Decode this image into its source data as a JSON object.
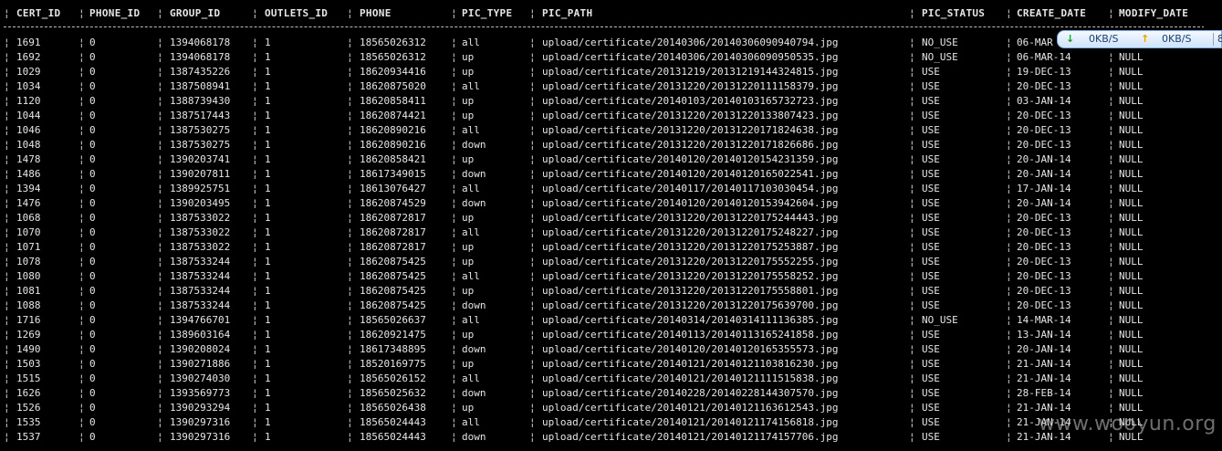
{
  "table": {
    "columns": [
      {
        "key": "cert_id",
        "label": "CERT_ID"
      },
      {
        "key": "phone_id",
        "label": "PHONE_ID"
      },
      {
        "key": "group_id",
        "label": "GROUP_ID"
      },
      {
        "key": "outlets_id",
        "label": "OUTLETS_ID"
      },
      {
        "key": "phone",
        "label": "PHONE"
      },
      {
        "key": "pic_type",
        "label": "PIC_TYPE"
      },
      {
        "key": "pic_path",
        "label": "PIC_PATH"
      },
      {
        "key": "pic_status",
        "label": "PIC_STATUS"
      },
      {
        "key": "create_date",
        "label": "CREATE_DATE"
      },
      {
        "key": "modify_date",
        "label": "MODIFY_DATE"
      }
    ],
    "rows": [
      [
        "1691",
        "0",
        "1394068178",
        "1",
        "18565026312",
        "all",
        "upload/certificate/20140306/20140306090940794.jpg",
        "NO_USE",
        "06-MAR",
        ""
      ],
      [
        "1692",
        "0",
        "1394068178",
        "1",
        "18565026312",
        "up",
        "upload/certificate/20140306/20140306090950535.jpg",
        "NO_USE",
        "06-MAR-14",
        "NULL"
      ],
      [
        "1029",
        "0",
        "1387435226",
        "1",
        "18620934416",
        "up",
        "upload/certificate/20131219/20131219144324815.jpg",
        "USE",
        "19-DEC-13",
        "NULL"
      ],
      [
        "1034",
        "0",
        "1387508941",
        "1",
        "18620875020",
        "all",
        "upload/certificate/20131220/20131220111158379.jpg",
        "USE",
        "20-DEC-13",
        "NULL"
      ],
      [
        "1120",
        "0",
        "1388739430",
        "1",
        "18620858411",
        "up",
        "upload/certificate/20140103/20140103165732723.jpg",
        "USE",
        "03-JAN-14",
        "NULL"
      ],
      [
        "1044",
        "0",
        "1387517443",
        "1",
        "18620874421",
        "up",
        "upload/certificate/20131220/20131220133807423.jpg",
        "USE",
        "20-DEC-13",
        "NULL"
      ],
      [
        "1046",
        "0",
        "1387530275",
        "1",
        "18620890216",
        "all",
        "upload/certificate/20131220/20131220171824638.jpg",
        "USE",
        "20-DEC-13",
        "NULL"
      ],
      [
        "1048",
        "0",
        "1387530275",
        "1",
        "18620890216",
        "down",
        "upload/certificate/20131220/20131220171826686.jpg",
        "USE",
        "20-DEC-13",
        "NULL"
      ],
      [
        "1478",
        "0",
        "1390203741",
        "1",
        "18620858421",
        "up",
        "upload/certificate/20140120/20140120154231359.jpg",
        "USE",
        "20-JAN-14",
        "NULL"
      ],
      [
        "1486",
        "0",
        "1390207811",
        "1",
        "18617349015",
        "down",
        "upload/certificate/20140120/20140120165022541.jpg",
        "USE",
        "20-JAN-14",
        "NULL"
      ],
      [
        "1394",
        "0",
        "1389925751",
        "1",
        "18613076427",
        "all",
        "upload/certificate/20140117/20140117103030454.jpg",
        "USE",
        "17-JAN-14",
        "NULL"
      ],
      [
        "1476",
        "0",
        "1390203495",
        "1",
        "18620874529",
        "down",
        "upload/certificate/20140120/20140120153942604.jpg",
        "USE",
        "20-JAN-14",
        "NULL"
      ],
      [
        "1068",
        "0",
        "1387533022",
        "1",
        "18620872817",
        "up",
        "upload/certificate/20131220/20131220175244443.jpg",
        "USE",
        "20-DEC-13",
        "NULL"
      ],
      [
        "1070",
        "0",
        "1387533022",
        "1",
        "18620872817",
        "all",
        "upload/certificate/20131220/20131220175248227.jpg",
        "USE",
        "20-DEC-13",
        "NULL"
      ],
      [
        "1071",
        "0",
        "1387533022",
        "1",
        "18620872817",
        "up",
        "upload/certificate/20131220/20131220175253887.jpg",
        "USE",
        "20-DEC-13",
        "NULL"
      ],
      [
        "1078",
        "0",
        "1387533244",
        "1",
        "18620875425",
        "up",
        "upload/certificate/20131220/20131220175552255.jpg",
        "USE",
        "20-DEC-13",
        "NULL"
      ],
      [
        "1080",
        "0",
        "1387533244",
        "1",
        "18620875425",
        "all",
        "upload/certificate/20131220/20131220175558252.jpg",
        "USE",
        "20-DEC-13",
        "NULL"
      ],
      [
        "1081",
        "0",
        "1387533244",
        "1",
        "18620875425",
        "up",
        "upload/certificate/20131220/20131220175558801.jpg",
        "USE",
        "20-DEC-13",
        "NULL"
      ],
      [
        "1088",
        "0",
        "1387533244",
        "1",
        "18620875425",
        "down",
        "upload/certificate/20131220/20131220175639700.jpg",
        "USE",
        "20-DEC-13",
        "NULL"
      ],
      [
        "1716",
        "0",
        "1394766701",
        "1",
        "18565026637",
        "all",
        "upload/certificate/20140314/20140314111136385.jpg",
        "NO_USE",
        "14-MAR-14",
        "NULL"
      ],
      [
        "1269",
        "0",
        "1389603164",
        "1",
        "18620921475",
        "up",
        "upload/certificate/20140113/20140113165241858.jpg",
        "USE",
        "13-JAN-14",
        "NULL"
      ],
      [
        "1490",
        "0",
        "1390208024",
        "1",
        "18617348895",
        "down",
        "upload/certificate/20140120/20140120165355573.jpg",
        "USE",
        "20-JAN-14",
        "NULL"
      ],
      [
        "1503",
        "0",
        "1390271886",
        "1",
        "18520169775",
        "up",
        "upload/certificate/20140121/20140121103816230.jpg",
        "USE",
        "21-JAN-14",
        "NULL"
      ],
      [
        "1515",
        "0",
        "1390274030",
        "1",
        "18565026152",
        "all",
        "upload/certificate/20140121/20140121111515838.jpg",
        "USE",
        "21-JAN-14",
        "NULL"
      ],
      [
        "1626",
        "0",
        "1393569773",
        "1",
        "18565025632",
        "down",
        "upload/certificate/20140228/20140228144307570.jpg",
        "USE",
        "28-FEB-14",
        "NULL"
      ],
      [
        "1526",
        "0",
        "1390293294",
        "1",
        "18565026438",
        "up",
        "upload/certificate/20140121/20140121163612543.jpg",
        "USE",
        "21-JAN-14",
        "NULL"
      ],
      [
        "1535",
        "0",
        "1390297316",
        "1",
        "18565024443",
        "all",
        "upload/certificate/20140121/20140121174156818.jpg",
        "USE",
        "21-JAN-14",
        "NULL"
      ],
      [
        "1537",
        "0",
        "1390297316",
        "1",
        "18565024443",
        "down",
        "upload/certificate/20140121/20140121174157706.jpg",
        "USE",
        "21-JAN-14",
        "NULL"
      ]
    ]
  },
  "speed_widget": {
    "download_icon": "arrow-down-icon",
    "download_arrow": "↓",
    "download_value": "0KB/S",
    "upload_icon": "arrow-up-icon",
    "upload_arrow": "↑",
    "upload_value": "0KB/S",
    "extra": "8"
  },
  "watermark": {
    "text": "www.wooyun.org"
  },
  "colors": {
    "background": "#000000",
    "text": "#e6e6e6",
    "widget_border": "#7ba7e0"
  }
}
